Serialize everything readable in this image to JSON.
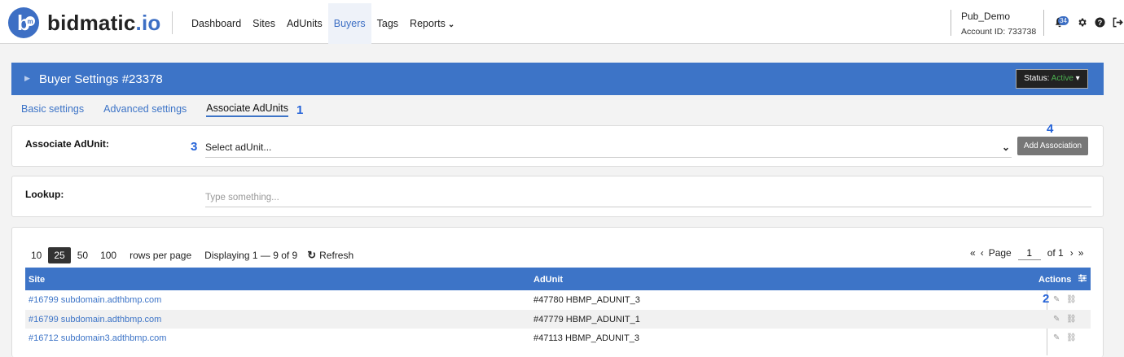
{
  "app": {
    "logo_b": "b",
    "logo_m": "m",
    "logo_name": "bidmatic",
    "logo_suffix": ".io"
  },
  "nav": {
    "items": [
      {
        "label": "Dashboard"
      },
      {
        "label": "Sites"
      },
      {
        "label": "AdUnits"
      },
      {
        "label": "Buyers"
      },
      {
        "label": "Tags"
      },
      {
        "label": "Reports"
      }
    ],
    "active": "Buyers"
  },
  "account": {
    "name": "Pub_Demo",
    "id_text": "Account ID: 733738",
    "notification_count": "34"
  },
  "header": {
    "title": "Buyer Settings #23378",
    "status_label": "Status:",
    "status_value": "Active",
    "status_color": "#4caf50",
    "bar_color": "#3d74c7"
  },
  "tabs": [
    {
      "label": "Basic settings"
    },
    {
      "label": "Advanced settings"
    },
    {
      "label": "Associate AdUnits"
    }
  ],
  "annotations": {
    "a1": "1",
    "a2": "2",
    "a3": "3",
    "a4": "4"
  },
  "associate": {
    "label": "Associate AdUnit:",
    "select_value": "Select adUnit...",
    "button": "Add Association"
  },
  "lookup": {
    "label": "Lookup:",
    "placeholder": "Type something..."
  },
  "pager": {
    "sizes": [
      "10",
      "25",
      "50",
      "100"
    ],
    "selected": "25",
    "rows_per_page": "rows per page",
    "displaying": "Displaying 1 — 9 of 9",
    "refresh": "Refresh",
    "first": "«",
    "prev": "‹",
    "page_label": "Page",
    "page_value": "1",
    "of": "of 1",
    "next": "›",
    "last": "»"
  },
  "table": {
    "columns": [
      "Site",
      "AdUnit",
      "Actions"
    ],
    "rows": [
      {
        "site": "#16799 subdomain.adthbmp.com",
        "adunit": "#47780 HBMP_ADUNIT_3"
      },
      {
        "site": "#16799 subdomain.adthbmp.com",
        "adunit": "#47779 HBMP_ADUNIT_1"
      },
      {
        "site": "#16712 subdomain3.adthbmp.com",
        "adunit": "#47113 HBMP_ADUNIT_3"
      }
    ]
  }
}
